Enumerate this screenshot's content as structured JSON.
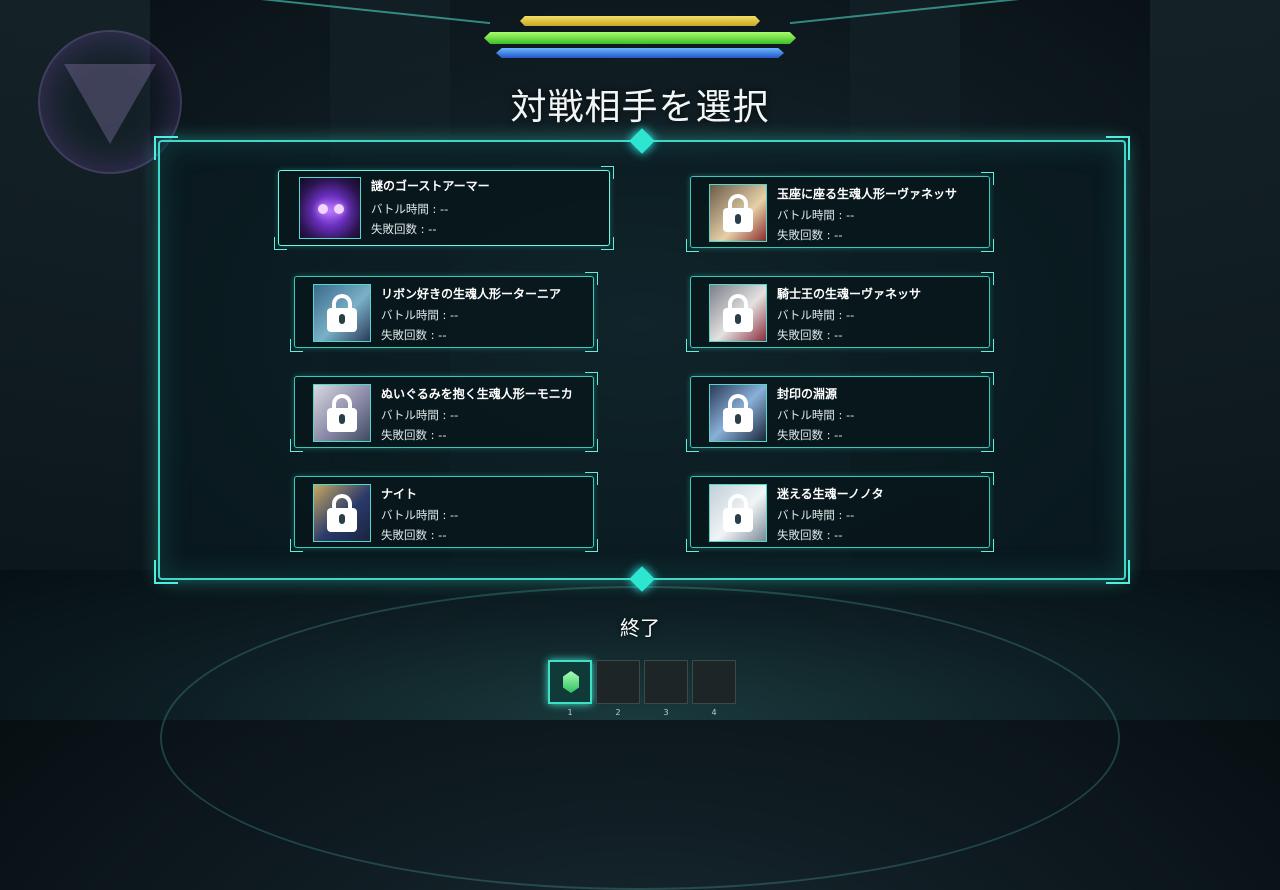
{
  "title": "対戦相手を選択",
  "hud": {
    "bar_colors": [
      "#f4e066",
      "#6bff4a",
      "#3a7bff"
    ]
  },
  "opponents": [
    {
      "name": "謎のゴーストアーマー",
      "battle_time": "バトル時間 : --",
      "fail_count": "失敗回数 : --",
      "locked": false,
      "selected": true
    },
    {
      "name": "玉座に座る生魂人形ーヴァネッサ",
      "battle_time": "バトル時間 : --",
      "fail_count": "失敗回数 : --",
      "locked": true
    },
    {
      "name": "リボン好きの生魂人形ーターニア",
      "battle_time": "バトル時間 : --",
      "fail_count": "失敗回数 : --",
      "locked": true
    },
    {
      "name": "騎士王の生魂ーヴァネッサ",
      "battle_time": "バトル時間 : --",
      "fail_count": "失敗回数 : --",
      "locked": true
    },
    {
      "name": "ぬいぐるみを抱く生魂人形ーモニカ",
      "battle_time": "バトル時間 : --",
      "fail_count": "失敗回数 : --",
      "locked": true
    },
    {
      "name": "封印の淵源",
      "battle_time": "バトル時間 : --",
      "fail_count": "失敗回数 : --",
      "locked": true
    },
    {
      "name": "ナイト",
      "battle_time": "バトル時間 : --",
      "fail_count": "失敗回数 : --",
      "locked": true
    },
    {
      "name": "迷える生魂ーノノタ",
      "battle_time": "バトル時間 : --",
      "fail_count": "失敗回数 : --",
      "locked": true
    }
  ],
  "quit_label": "終了",
  "slots": [
    {
      "number": "1",
      "active": true,
      "icon": "green-crystal-icon"
    },
    {
      "number": "2",
      "active": false
    },
    {
      "number": "3",
      "active": false
    },
    {
      "number": "4",
      "active": false
    }
  ],
  "colors": {
    "accent": "#3fd8c8",
    "panel_border": "#3fd8c8"
  }
}
